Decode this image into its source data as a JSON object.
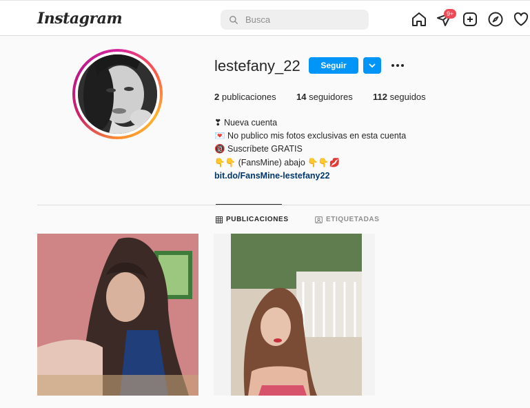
{
  "header": {
    "logo_text": "Instagram",
    "search_placeholder": "Busca",
    "notification_badge": "9+",
    "icons": [
      "home-icon",
      "direct-icon",
      "new-post-icon",
      "explore-icon",
      "activity-icon"
    ]
  },
  "profile": {
    "username": "lestefany_22",
    "follow_label": "Seguir",
    "stats": [
      {
        "count": "2",
        "label": "publicaciones"
      },
      {
        "count": "14",
        "label": "seguidores"
      },
      {
        "count": "112",
        "label": "seguidos"
      }
    ],
    "bio_lines": [
      "❣ Nueva cuenta",
      "💌 No publico mis fotos exclusivas en esta cuenta",
      "🔞 Suscríbete GRATIS",
      "👇👇 (FansMine) abajo 👇👇💋"
    ],
    "bio_link": "bit.do/FansMine-lestefany22"
  },
  "tabs": [
    {
      "label": "PUBLICACIONES",
      "active": true
    },
    {
      "label": "ETIQUETADAS",
      "active": false
    }
  ],
  "colors": {
    "accent": "#0095f6",
    "badge": "#ed4956",
    "link": "#00376b"
  }
}
